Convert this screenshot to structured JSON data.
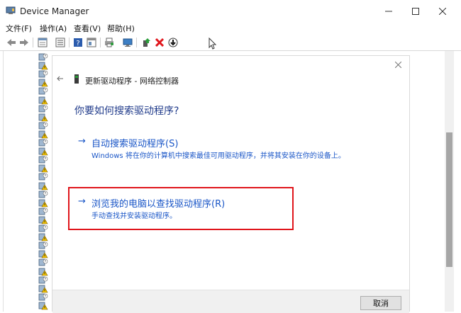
{
  "window": {
    "title": "Device Manager"
  },
  "menubar": [
    {
      "label": "文件(F)"
    },
    {
      "label": "操作(A)"
    },
    {
      "label": "查看(V)"
    },
    {
      "label": "帮助(H)"
    }
  ],
  "toolbar": {
    "buttons": [
      "back-icon",
      "forward-icon",
      "properties-icon",
      "device-list-icon",
      "help-icon",
      "view-icon",
      "print-icon",
      "monitor-icon",
      "update-driver-icon",
      "uninstall-icon",
      "download-icon"
    ],
    "colors": {
      "update": "#2a9d3a",
      "uninstall": "#e0151b"
    }
  },
  "device_tree": {
    "icon_count": 30,
    "icons": [
      "hardware-icon",
      "warning-icon"
    ]
  },
  "dialog": {
    "title": "更新驱动程序 - 网络控制器",
    "heading": "你要如何搜索驱动程序?",
    "option_auto": {
      "title": "自动搜索驱动程序(S)",
      "desc": "Windows 将在你的计算机中搜索最佳可用驱动程序，并将其安装在你的设备上。"
    },
    "option_browse": {
      "title": "浏览我的电脑以查找驱动程序(R)",
      "desc": "手动查找并安装驱动程序。"
    },
    "cancel_label": "取消",
    "highlight_color": "#e0151b"
  }
}
